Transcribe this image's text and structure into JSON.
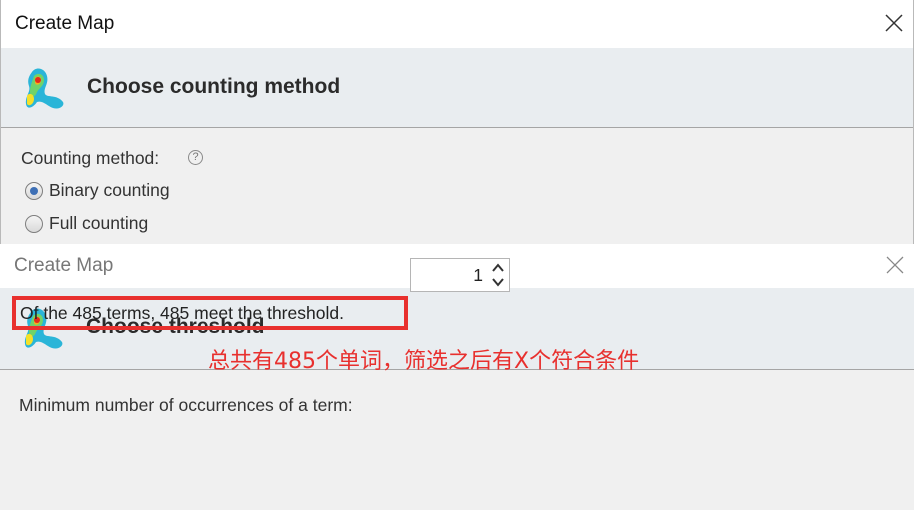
{
  "top_dialog": {
    "title": "Create Map",
    "heading": "Choose counting method",
    "counting_method_label": "Counting method:",
    "help_glyph": "?",
    "options": [
      {
        "label": "Binary counting",
        "selected": true
      },
      {
        "label": "Full counting",
        "selected": false
      }
    ]
  },
  "bottom_dialog": {
    "title": "Create Map",
    "heading": "Choose threshold",
    "min_occurrences_label": "Minimum number of occurrences of a term:",
    "min_occurrences_value": "1",
    "result_text": "Of the 485 terms, 485 meet the threshold."
  },
  "annotation": {
    "text": "总共有485个单词，筛选之后有X个符合条件",
    "color": "#e8302e"
  },
  "icons": {
    "close": "close-icon",
    "help": "help-icon",
    "app_logo": "vosviewer-logo-icon",
    "spinner_up": "spinner-up-icon",
    "spinner_down": "spinner-down-icon"
  }
}
